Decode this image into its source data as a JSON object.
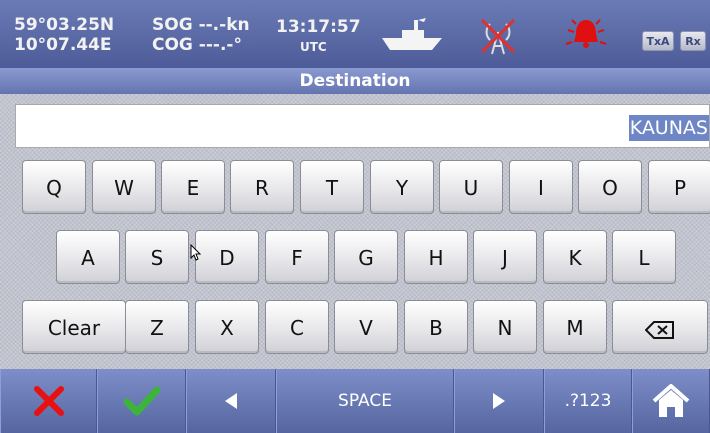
{
  "status": {
    "lat": "59°03.25N",
    "lon": "10°07.44E",
    "sog": "SOG --.-kn",
    "cog": "COG ---.-°",
    "time": "13:17:57",
    "tz": "UTC",
    "txa": "TxA",
    "rx": "Rx",
    "icons": [
      "ship-icon",
      "no-antenna-icon",
      "alarm-bell-icon"
    ],
    "colors": {
      "alarm": "#e01010",
      "antenna_cross": "#e03030"
    }
  },
  "title": "Destination",
  "input": {
    "value": "KAUNAS"
  },
  "keys": {
    "row1": [
      "Q",
      "W",
      "E",
      "R",
      "T",
      "Y",
      "U",
      "I",
      "O",
      "P"
    ],
    "row2": [
      "A",
      "S",
      "D",
      "F",
      "G",
      "H",
      "J",
      "K",
      "L"
    ],
    "row3": [
      "Clear",
      "Z",
      "X",
      "C",
      "V",
      "B",
      "N",
      "M"
    ],
    "backspace_icon": "backspace-icon"
  },
  "bottom": {
    "space": "SPACE",
    "symbols": ".?123",
    "icons": [
      "cancel-icon",
      "confirm-icon",
      "arrow-left-icon",
      "arrow-right-icon",
      "home-icon"
    ],
    "colors": {
      "cancel": "#e81010",
      "confirm": "#3cb43c"
    }
  }
}
